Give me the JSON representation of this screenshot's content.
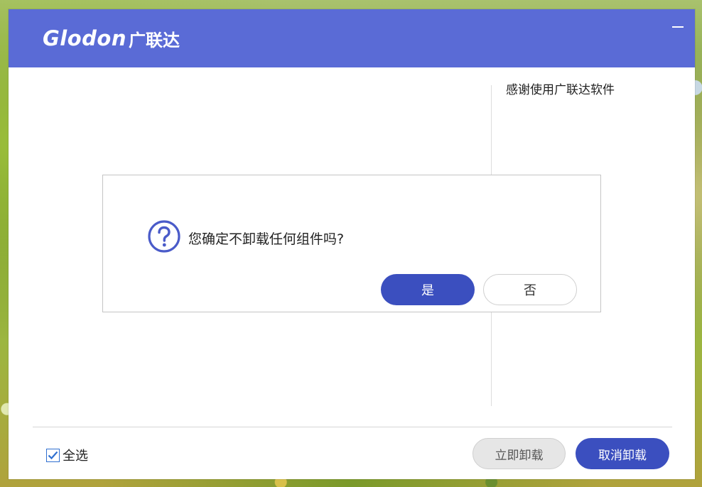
{
  "window": {
    "logo_mark": "Glodon",
    "logo_cn": "广联达",
    "minimize_icon": "minimize-icon"
  },
  "main": {
    "thanks_text": "感谢使用广联达软件"
  },
  "footer": {
    "select_all_label": "全选",
    "select_all_checked": true,
    "uninstall_now_label": "立即卸载",
    "cancel_uninstall_label": "取消卸载"
  },
  "dialog": {
    "icon": "question-circle-icon",
    "message": "您确定不卸载任何组件吗?",
    "yes_label": "是",
    "no_label": "否"
  },
  "colors": {
    "titlebar": "#5a6bd6",
    "primary_button": "#3b4fbf",
    "checkbox_accent": "#2f6fd0"
  }
}
